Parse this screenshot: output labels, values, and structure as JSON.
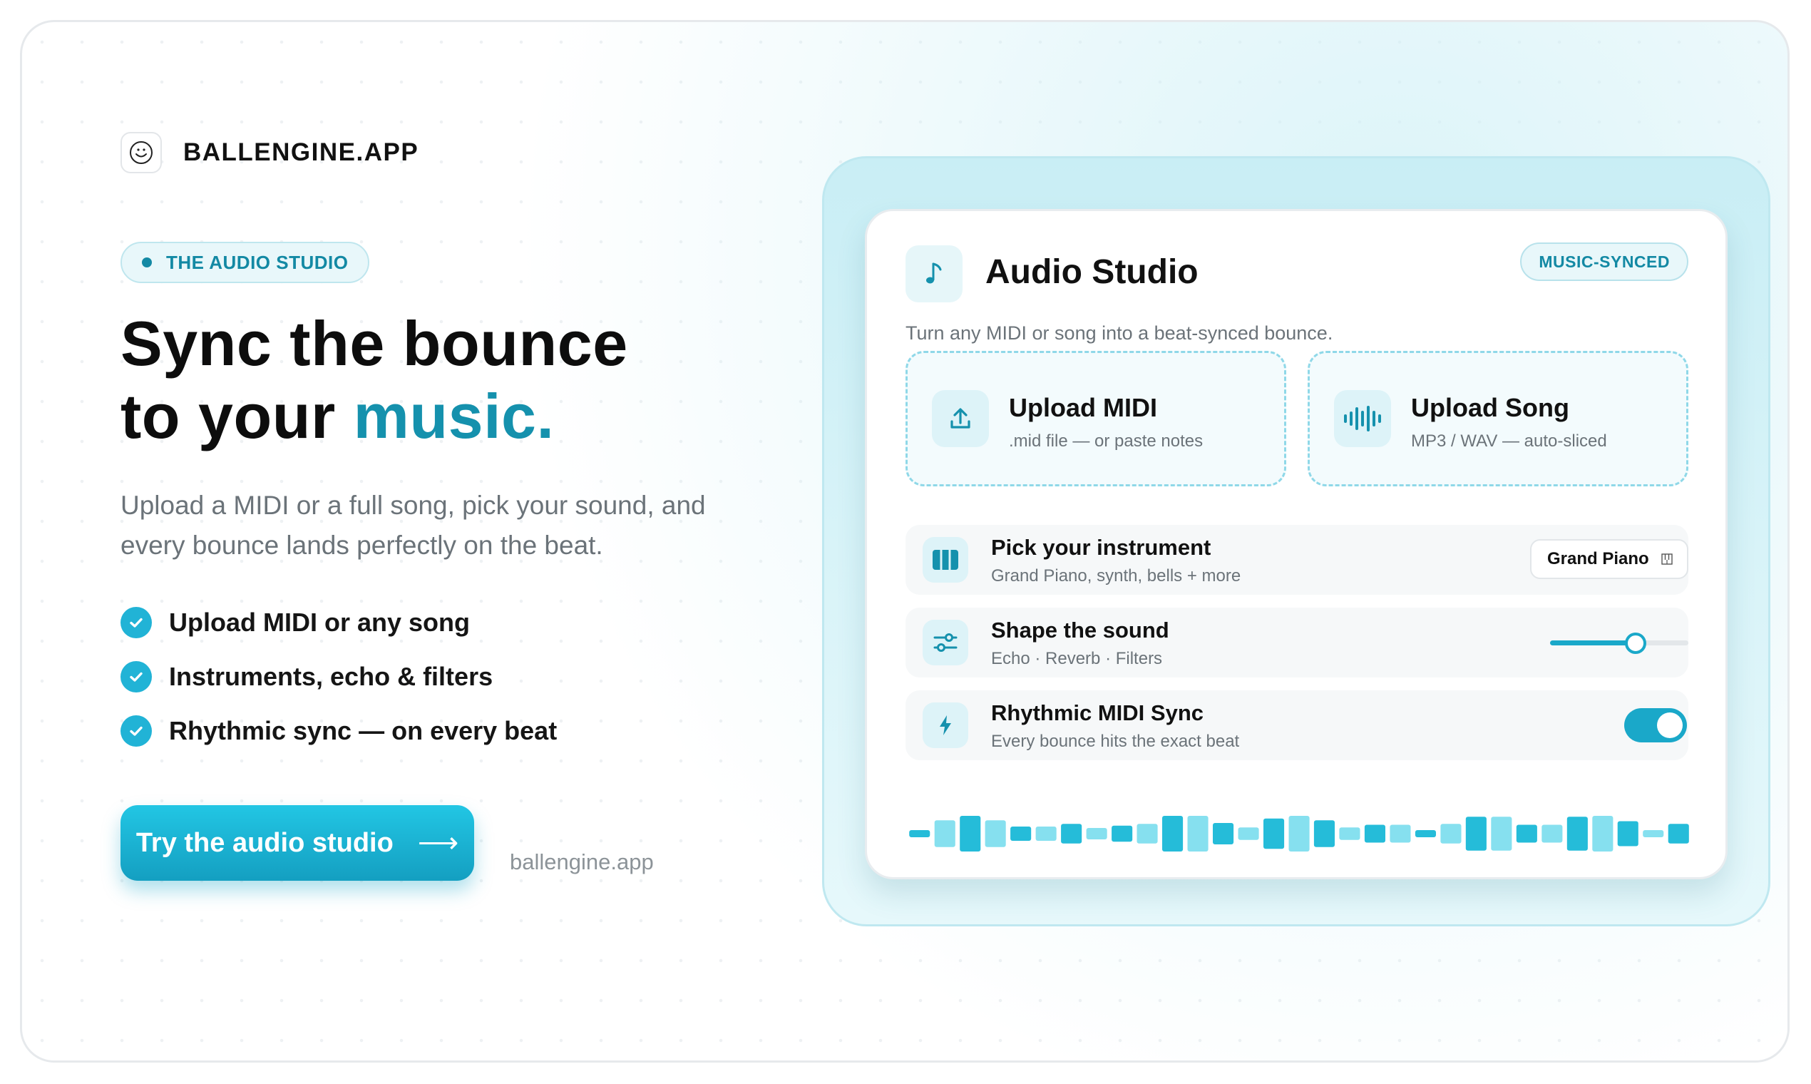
{
  "brand": {
    "name": "BALLENGINE.APP"
  },
  "hero": {
    "badge": "THE AUDIO STUDIO",
    "headline_line1": "Sync the bounce",
    "headline_line2_prefix": "to your ",
    "headline_accent": "music.",
    "subtext": "Upload a MIDI or a full song, pick your sound, and every bounce lands perfectly on the beat.",
    "features": [
      "Upload MIDI or any song",
      "Instruments, echo & filters",
      "Rhythmic sync — on every beat"
    ],
    "cta_label": "Try the audio studio",
    "cta_arrow": "⟶",
    "url": "ballengine.app"
  },
  "studio": {
    "icon": "music-note-icon",
    "title": "Audio Studio",
    "badge": "MUSIC-SYNCED",
    "subtitle": "Turn any MIDI or song into a beat-synced bounce.",
    "uploads": [
      {
        "icon": "upload-icon",
        "title": "Upload MIDI",
        "sub": ".mid file — or paste notes"
      },
      {
        "icon": "waveform-icon",
        "title": "Upload Song",
        "sub": "MP3 / WAV — auto-sliced"
      }
    ],
    "instrument": {
      "icon": "piano-keys-icon",
      "title": "Pick your instrument",
      "sub": "Grand Piano, synth, bells + more",
      "selected": "Grand Piano"
    },
    "sound": {
      "icon": "sliders-icon",
      "title": "Shape the sound",
      "sub": "Echo · Reverb · Filters",
      "level": 0.62
    },
    "sync": {
      "icon": "lightning-icon",
      "title": "Rhythmic MIDI Sync",
      "sub": "Every bounce hits the exact beat",
      "enabled": true
    },
    "waveform_levels": [
      0.2,
      0.75,
      1,
      0.75,
      0.4,
      0.4,
      0.55,
      0.32,
      0.45,
      0.55,
      1,
      1,
      0.6,
      0.35,
      0.85,
      1,
      0.75,
      0.35,
      0.5,
      0.5,
      0.2,
      0.55,
      0.95,
      0.95,
      0.5,
      0.5,
      0.95,
      1,
      0.7,
      0.2,
      0.55
    ]
  },
  "colors": {
    "accent": "#1591ad",
    "cta": "#1aa8c9",
    "wave_primary": "#25bcd9",
    "wave_light": "#86e0ef"
  }
}
